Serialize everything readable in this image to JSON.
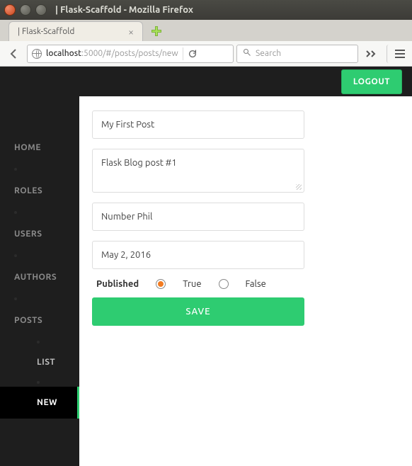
{
  "window": {
    "title": "| Flask-Scaffold - Mozilla Firefox"
  },
  "tab": {
    "title": "| Flask-Scaffold"
  },
  "url": {
    "host": "localhost",
    "path": ":5000/#/posts/posts/new"
  },
  "search": {
    "placeholder": "Search"
  },
  "header": {
    "logout": "LOGOUT"
  },
  "sidebar": {
    "items": [
      {
        "label": "HOME"
      },
      {
        "label": "ROLES"
      },
      {
        "label": "USERS"
      },
      {
        "label": "AUTHORS"
      },
      {
        "label": "POSTS"
      }
    ],
    "sub": [
      {
        "label": "LIST"
      },
      {
        "label": "NEW"
      }
    ]
  },
  "form": {
    "title_value": "My First Post",
    "body_value": "Flask Blog post #1",
    "author_value": "Number Phil",
    "date_value": "May 2, 2016",
    "published_label": "Published",
    "true_label": "True",
    "false_label": "False",
    "save": "SAVE"
  }
}
